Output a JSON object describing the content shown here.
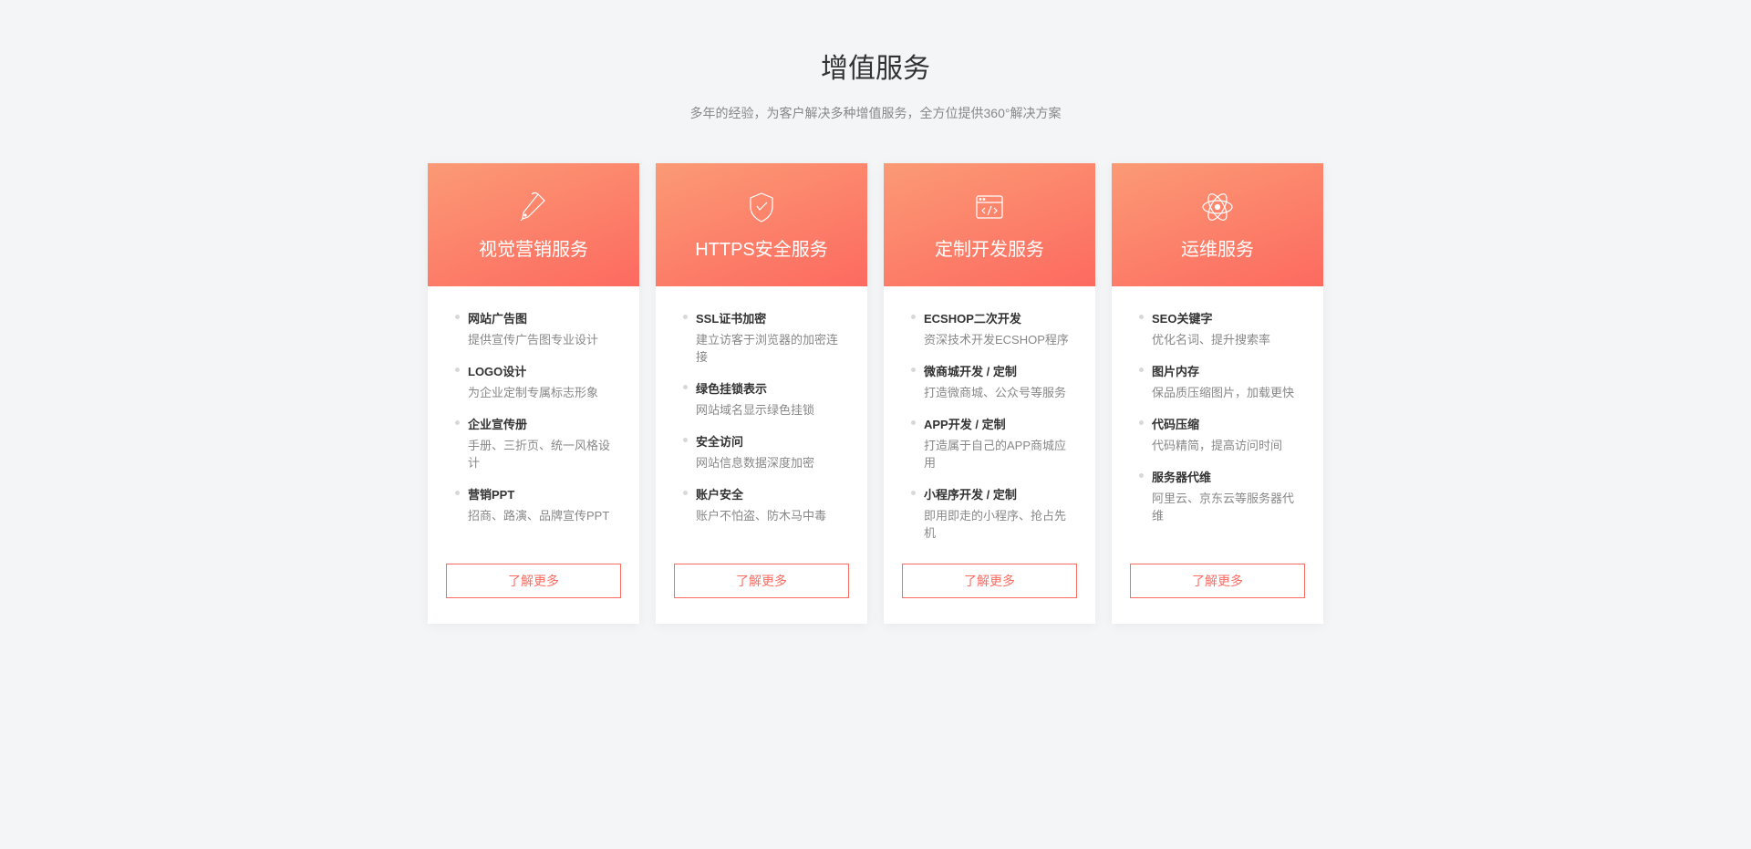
{
  "header": {
    "title": "增值服务",
    "subtitle": "多年的经验，为客户解决多种增值服务，全方位提供360°解决方案"
  },
  "cards": [
    {
      "icon": "pen-icon",
      "title": "视觉营销服务",
      "features": [
        {
          "title": "网站广告图",
          "desc": "提供宣传广告图专业设计"
        },
        {
          "title": "LOGO设计",
          "desc": "为企业定制专属标志形象"
        },
        {
          "title": "企业宣传册",
          "desc": "手册、三折页、统一风格设计"
        },
        {
          "title": "营销PPT",
          "desc": "招商、路演、品牌宣传PPT"
        }
      ],
      "button": "了解更多"
    },
    {
      "icon": "shield-icon",
      "title": "HTTPS安全服务",
      "features": [
        {
          "title": "SSL证书加密",
          "desc": "建立访客于浏览器的加密连接"
        },
        {
          "title": "绿色挂锁表示",
          "desc": "网站域名显示绿色挂锁"
        },
        {
          "title": "安全访问",
          "desc": "网站信息数据深度加密"
        },
        {
          "title": "账户安全",
          "desc": "账户不怕盗、防木马中毒"
        }
      ],
      "button": "了解更多"
    },
    {
      "icon": "browser-icon",
      "title": "定制开发服务",
      "features": [
        {
          "title": "ECSHOP二次开发",
          "desc": "资深技术开发ECSHOP程序"
        },
        {
          "title": "微商城开发 / 定制",
          "desc": "打造微商城、公众号等服务"
        },
        {
          "title": "APP开发 / 定制",
          "desc": "打造属于自己的APP商城应用"
        },
        {
          "title": "小程序开发 / 定制",
          "desc": "即用即走的小程序、抢占先机"
        }
      ],
      "button": "了解更多"
    },
    {
      "icon": "atom-icon",
      "title": "运维服务",
      "features": [
        {
          "title": "SEO关键字",
          "desc": "优化名词、提升搜索率"
        },
        {
          "title": "图片内存",
          "desc": "保品质压缩图片，加载更快"
        },
        {
          "title": "代码压缩",
          "desc": "代码精简，提高访问时间"
        },
        {
          "title": "服务器代维",
          "desc": "阿里云、京东云等服务器代维"
        }
      ],
      "button": "了解更多"
    }
  ]
}
